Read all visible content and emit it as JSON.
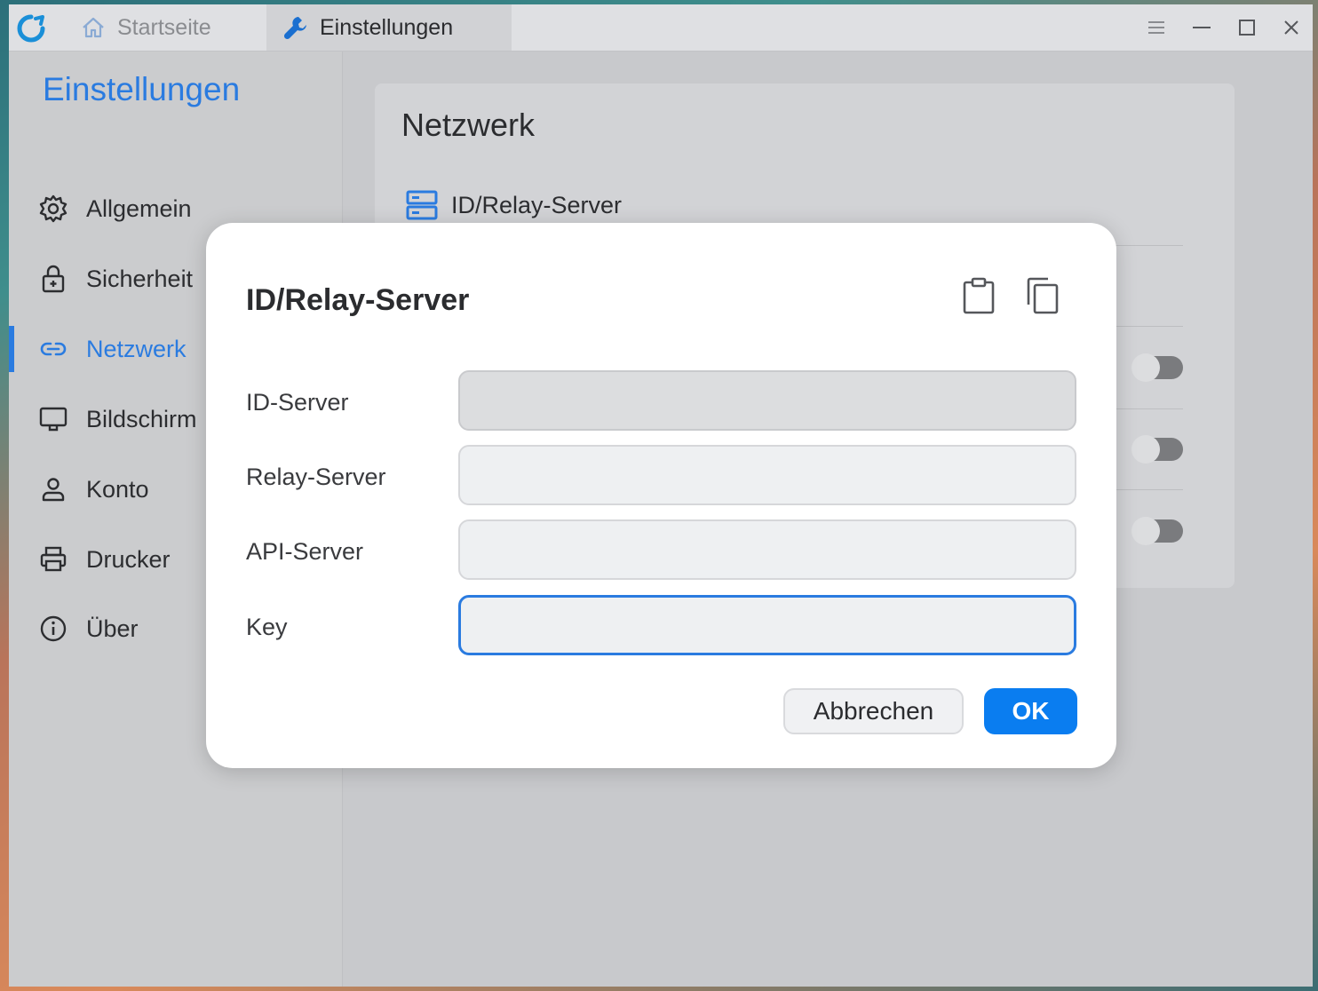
{
  "titlebar": {
    "tabs": [
      {
        "label": "Startseite",
        "icon": "home-icon"
      },
      {
        "label": "Einstellungen",
        "icon": "wrench-icon"
      }
    ],
    "controls": [
      "menu-icon",
      "minimize-icon",
      "maximize-icon",
      "close-icon"
    ]
  },
  "sidebar": {
    "title": "Einstellungen",
    "items": [
      {
        "label": "Allgemein",
        "icon": "gear-icon"
      },
      {
        "label": "Sicherheit",
        "icon": "lock-icon"
      },
      {
        "label": "Netzwerk",
        "icon": "link-icon",
        "active": true
      },
      {
        "label": "Bildschirm",
        "icon": "monitor-icon"
      },
      {
        "label": "Konto",
        "icon": "person-icon"
      },
      {
        "label": "Drucker",
        "icon": "printer-icon"
      },
      {
        "label": "Über",
        "icon": "info-icon"
      }
    ]
  },
  "main": {
    "card_title": "Netzwerk",
    "row_label": "ID/Relay-Server"
  },
  "dialog": {
    "title": "ID/Relay-Server",
    "fields": [
      {
        "label": "ID-Server",
        "value": "",
        "state": "disabled"
      },
      {
        "label": "Relay-Server",
        "value": "",
        "state": "normal"
      },
      {
        "label": "API-Server",
        "value": "",
        "state": "normal"
      },
      {
        "label": "Key",
        "value": "",
        "state": "focused"
      }
    ],
    "cancel_label": "Abbrechen",
    "ok_label": "OK"
  },
  "colors": {
    "accent": "#2a7be0",
    "ok_button": "#0a7df0"
  }
}
